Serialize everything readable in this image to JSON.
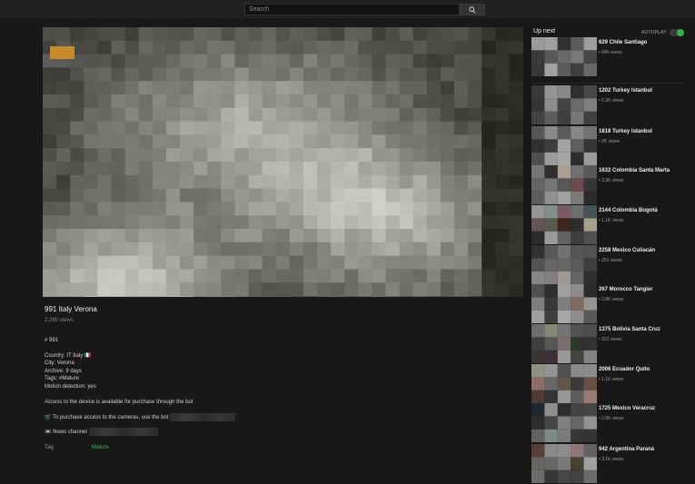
{
  "search": {
    "placeholder": "Search",
    "icon": "search-icon"
  },
  "video": {
    "title": "991 Italy Verona",
    "views": "2,280 views",
    "description": {
      "id_line": "# 991",
      "country": "Country: IT Italy 🇮🇹",
      "city": "City: Verona",
      "archive": "Archive: 9 days",
      "tags": "Tags: #Mature",
      "motion": "Motion detection: yes",
      "access": "Access to the device is available for purchase through the bot",
      "purchase": "🛒 To purchase access to the cameras, use the bot",
      "news": "📼 News channel"
    },
    "tag_label": "Tag",
    "tag_value": "Mature"
  },
  "sidebar": {
    "heading": "Up next",
    "autoplay_label": "AUTOPLAY",
    "autoplay_on": true,
    "items": [
      {
        "title": "629 Chile Santiago",
        "views": "• 846 views"
      },
      {
        "title": "1202 Turkey Istanbul",
        "views": "• 6.3K views"
      },
      {
        "title": "1818 Turkey Istanbul",
        "views": "• 2K views"
      },
      {
        "title": "1632 Colombia Santa Marta",
        "views": "• 3.3K views"
      },
      {
        "title": "2144 Colombia Bogotá",
        "views": "• 1.1K views"
      },
      {
        "title": "2258 Mexico Culiacán",
        "views": "• 252 views"
      },
      {
        "title": "267 Morocco Tangier",
        "views": "• 2.8K views"
      },
      {
        "title": "1375 Bolivia Santa Cruz",
        "views": "• 322 views"
      },
      {
        "title": "2006 Ecuador Quito",
        "views": "• 1.1K views"
      },
      {
        "title": "1725 Mexico Veracruz",
        "views": "• 2.9K views"
      },
      {
        "title": "942 Argentina Paraná",
        "views": "• 3.1K views"
      }
    ]
  },
  "colors": {
    "accent_green": "#3ec34a",
    "toggle_green": "#2fb344",
    "background": "#181818"
  }
}
